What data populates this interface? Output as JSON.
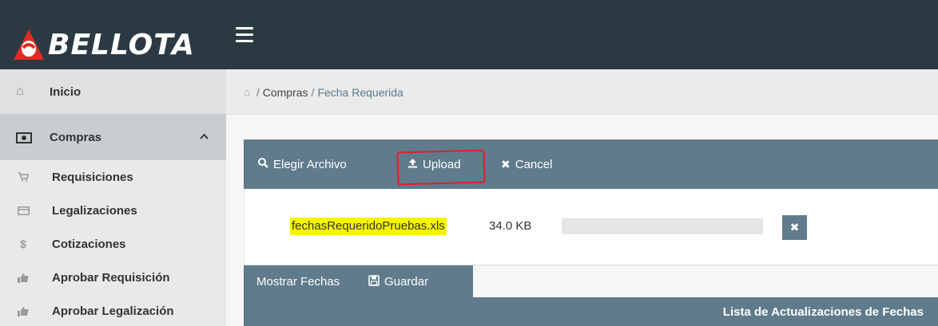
{
  "brand": {
    "name": "BELLOTA"
  },
  "colors": {
    "topbar": "#2b3a42",
    "accent": "#5f7b8c",
    "highlight": "#f5f500",
    "annotation": "#e0202a"
  },
  "sidebar": {
    "inicio": {
      "label": "Inicio",
      "icon": "home-icon"
    },
    "compras": {
      "label": "Compras",
      "icon": "money-icon"
    },
    "items": [
      {
        "label": "Requisiciones",
        "icon": "cart-icon"
      },
      {
        "label": "Legalizaciones",
        "icon": "card-icon"
      },
      {
        "label": "Cotizaciones",
        "icon": "dollar-icon"
      },
      {
        "label": "Aprobar Requisición",
        "icon": "thumbs-up-icon"
      },
      {
        "label": "Aprobar Legalización",
        "icon": "thumbs-up-icon"
      }
    ]
  },
  "breadcrumb": {
    "first": "Compras",
    "sep": "/",
    "current": "Fecha Requerida"
  },
  "upload": {
    "choose_label": "Elegir Archivo",
    "upload_label": "Upload",
    "cancel_label": "Cancel",
    "file_name": "fechasRequeridoPruebas.xls",
    "file_size": "34.0 KB",
    "progress": 0
  },
  "tabs": {
    "mostrar": "Mostrar Fechas",
    "guardar": "Guardar"
  },
  "table": {
    "title": "Lista de Actualizaciones de Fechas"
  }
}
